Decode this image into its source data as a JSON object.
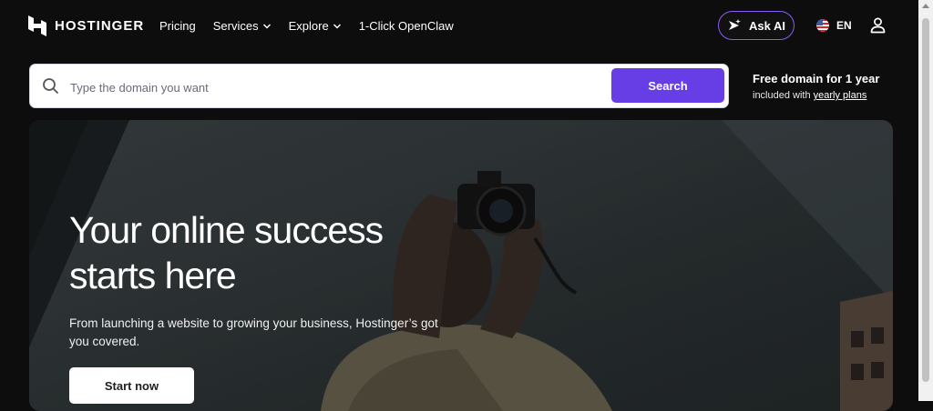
{
  "header": {
    "brand": "HOSTINGER",
    "nav": [
      {
        "label": "Pricing",
        "dropdown": false
      },
      {
        "label": "Services",
        "dropdown": true
      },
      {
        "label": "Explore",
        "dropdown": true
      },
      {
        "label": "1-Click OpenClaw",
        "dropdown": false
      }
    ],
    "ask_ai": "Ask AI",
    "language": "EN"
  },
  "search": {
    "placeholder": "Type the domain you want",
    "button": "Search"
  },
  "promo": {
    "title": "Free domain for 1 year",
    "sub_prefix": "included with ",
    "link": "yearly plans"
  },
  "hero": {
    "title": "Your online success starts here",
    "subtitle": "From launching a website to growing your business, Hostinger’s got you covered.",
    "cta": "Start now"
  },
  "colors": {
    "accent": "#673de6",
    "background": "#0d0d0d",
    "ask_ai_border": "#8b5cf6"
  },
  "icons": [
    "hostinger-logo",
    "chevron-down-icon",
    "sparkle-icon",
    "us-flag-icon",
    "user-icon",
    "search-icon"
  ]
}
